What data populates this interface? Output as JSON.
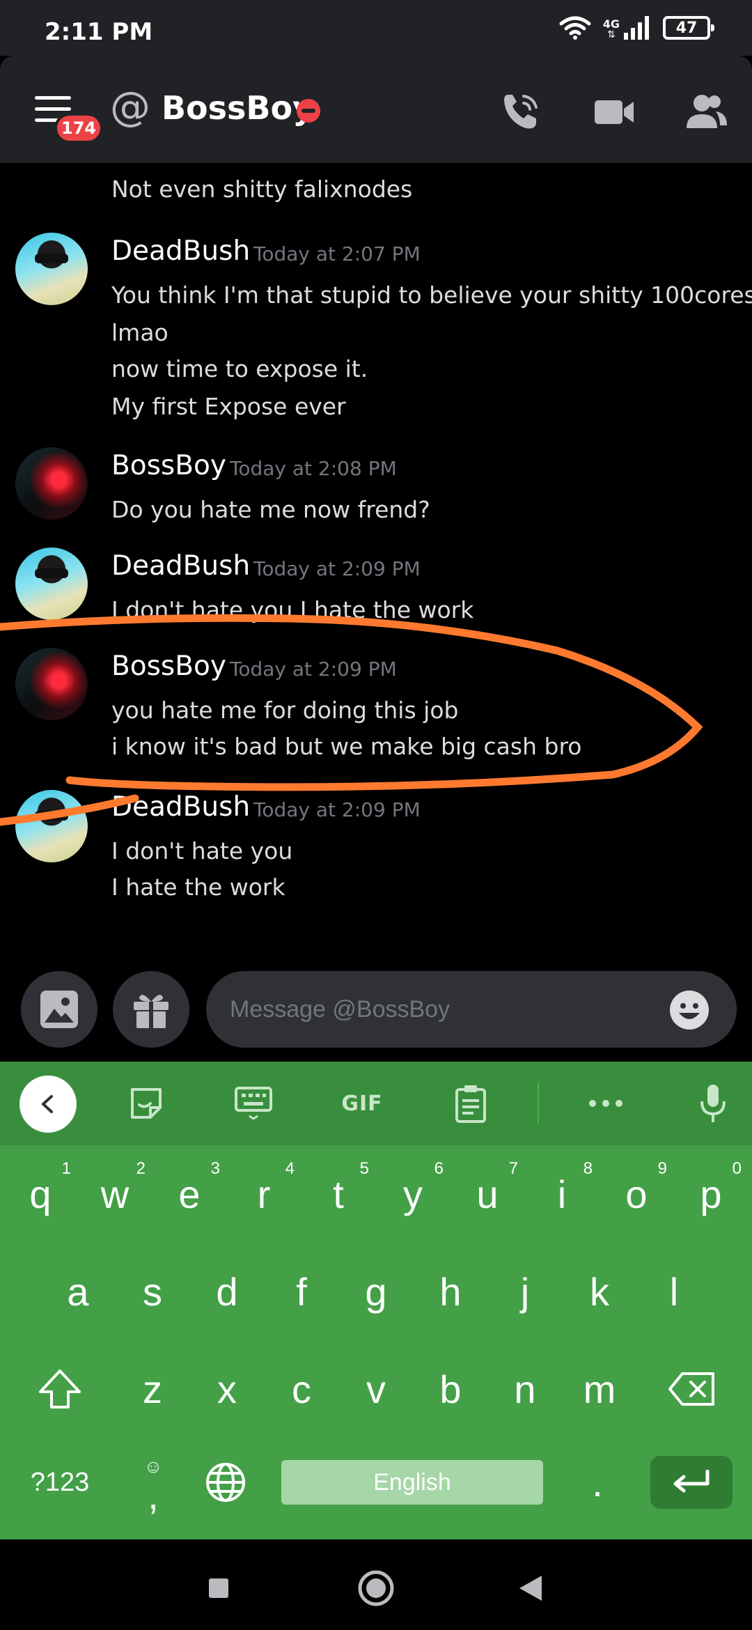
{
  "status": {
    "time": "2:11 PM",
    "network": "4G",
    "battery": "47"
  },
  "header": {
    "unread_badge": "174",
    "at_symbol": "@",
    "title": "BossBoy"
  },
  "messages": {
    "pre": {
      "line1": "Not even shitty falixnodes"
    },
    "m1": {
      "author": "DeadBush",
      "time": "Today at 2:07 PM",
      "line1": "You think I'm that stupid to believe your shitty 100cores",
      "line2": "lmao",
      "line3": "now time to expose it.",
      "line4": "My first Expose ever"
    },
    "m2": {
      "author": "BossBoy",
      "time": "Today at 2:08 PM",
      "line1": "Do you hate me now frend?"
    },
    "m3": {
      "author": "DeadBush",
      "time": "Today at 2:09 PM",
      "line1": "I don't hate you I hate the work"
    },
    "m4": {
      "author": "BossBoy",
      "time": "Today at 2:09 PM",
      "line1": "you hate me for doing this job",
      "line2": "i know it's bad but we make big cash bro"
    },
    "m5": {
      "author": "DeadBush",
      "time": "Today at 2:09 PM",
      "line1": "I don't hate you",
      "line2": "I hate the work"
    }
  },
  "input": {
    "placeholder": "Message @BossBoy"
  },
  "keyboard": {
    "gif_label": "GIF",
    "row1": [
      "q",
      "w",
      "e",
      "r",
      "t",
      "y",
      "u",
      "i",
      "o",
      "p"
    ],
    "row1_hints": [
      "1",
      "2",
      "3",
      "4",
      "5",
      "6",
      "7",
      "8",
      "9",
      "0"
    ],
    "row2": [
      "a",
      "s",
      "d",
      "f",
      "g",
      "h",
      "j",
      "k",
      "l"
    ],
    "row3": [
      "z",
      "x",
      "c",
      "v",
      "b",
      "n",
      "m"
    ],
    "symbols": "?123",
    "comma": ",",
    "period": ".",
    "space_label": "English"
  },
  "colors": {
    "annotation": "#ff7a2f",
    "keyboard": "#43a047",
    "header": "#202225",
    "dnd": "#ed4245"
  }
}
